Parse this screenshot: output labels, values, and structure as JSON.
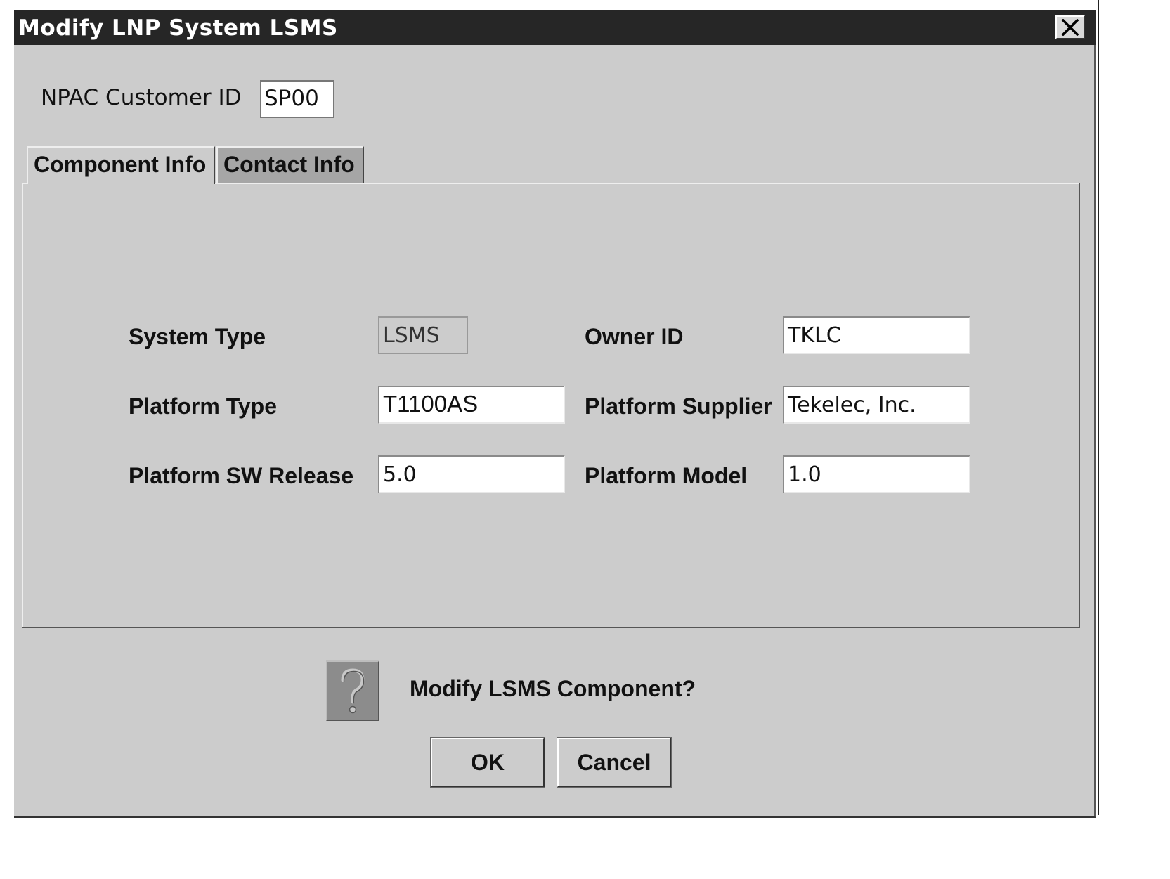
{
  "window": {
    "title": "Modify LNP System LSMS"
  },
  "npac": {
    "label": "NPAC Customer ID",
    "value": "SP00"
  },
  "tabs": [
    {
      "label": "Component Info",
      "selected": true
    },
    {
      "label": "Contact Info",
      "selected": false
    }
  ],
  "fields": {
    "system_type": {
      "label": "System Type",
      "value": "LSMS"
    },
    "owner_id": {
      "label": "Owner ID",
      "value": "TKLC"
    },
    "platform_type": {
      "label": "Platform Type",
      "value": "T1100AS"
    },
    "platform_supplier": {
      "label": "Platform Supplier",
      "value": "Tekelec, Inc."
    },
    "platform_sw_release": {
      "label": "Platform SW Release",
      "value": "5.0"
    },
    "platform_model": {
      "label": "Platform Model",
      "value": "1.0"
    }
  },
  "confirm": {
    "icon": "question-icon",
    "message": "Modify LSMS Component?",
    "ok_label": "OK",
    "cancel_label": "Cancel"
  },
  "colors": {
    "titlebar": "#262626",
    "dialog_bg": "#cccccc",
    "inactive_tab": "#a6a6a6"
  }
}
